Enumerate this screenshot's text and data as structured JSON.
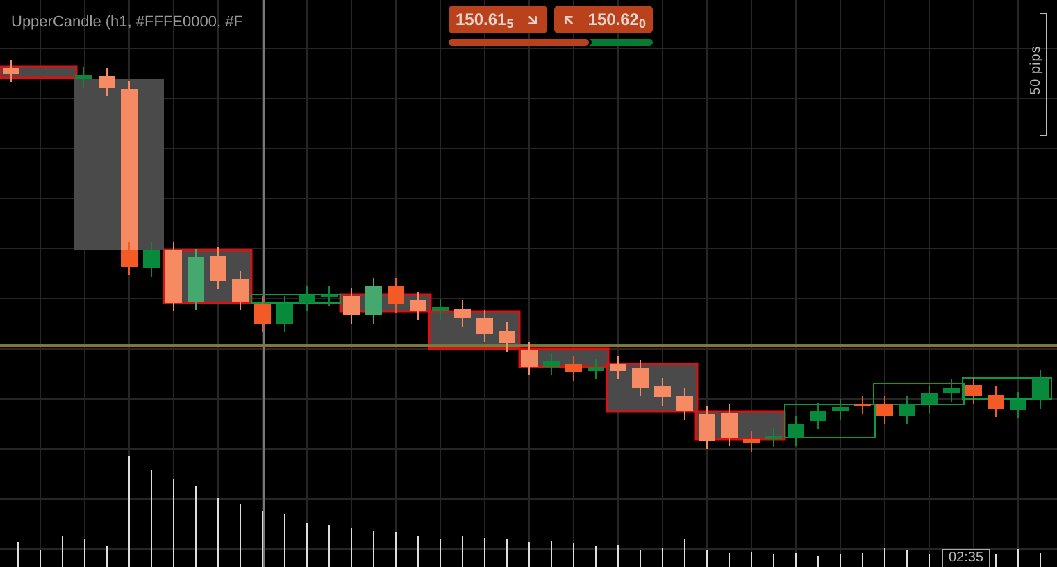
{
  "indicator_label": "UpperCandle (h1, #FFFE0000, #F",
  "quotes": [
    {
      "kind": "sell",
      "price": "150.61",
      "pipette": "5"
    },
    {
      "kind": "buy",
      "price": "150.62",
      "pipette": "0"
    }
  ],
  "sentiment": {
    "level": 0.69
  },
  "scale": {
    "label": "50 pips"
  },
  "time_marker": {
    "label": "02:35"
  }
}
